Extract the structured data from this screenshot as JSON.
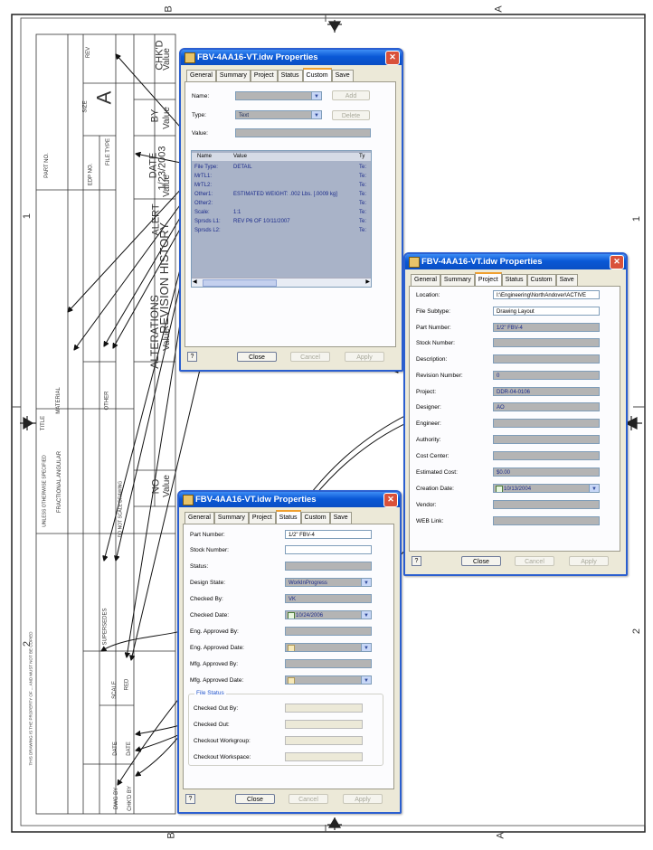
{
  "drawing": {
    "zone_letters": {
      "top_right": "B",
      "bottom_left": "B",
      "top_far_right": "A",
      "bottom_far_right": "A"
    },
    "zone_numbers": {
      "upper": "1",
      "lower": "2"
    },
    "title_block": {
      "part_no_label": "PART NO.",
      "rev_label": "REV",
      "size_label": "SIZE",
      "size_value": "A",
      "edp_no_label": "EDP NO.",
      "file_type_label": "FILE TYPE",
      "title_label": "TITLE",
      "material_label": "MATERIAL",
      "other_label": "OTHER",
      "unless_note": "UNLESS OTHERWISE SPECIFIED",
      "fractional": "FRACTIONAL   ANGULAR",
      "do_not_scale": "DO NOT SCALE DRAWING",
      "supersedes_label": "SUPERSEDES",
      "scale_label": "SCALE",
      "scale_value": "RED",
      "date_label": "DATE",
      "dwg_by_label": "DWG BY",
      "chkd_by_label": "CHK'D BY",
      "proprietary_note": "THIS DRAWING IS THE PROPERTY OF ... AND MUST NOT BE COPIED"
    },
    "revision_history": {
      "header": "REVISION HISTORY",
      "alterations_header": "ALTERATIONS",
      "columns": [
        "NO",
        "ALERT",
        "DATE",
        "BY",
        "CHK'D"
      ],
      "values": {
        "alert": "Value",
        "date": "1/23/2003",
        "by": "Value",
        "chkd": "Value",
        "no": "Value",
        "alterations": "Value"
      }
    }
  },
  "dialog_custom": {
    "title": "FBV-4AA16-VT.idw Properties",
    "tabs": [
      "General",
      "Summary",
      "Project",
      "Status",
      "Custom",
      "Save"
    ],
    "active_tab": "Custom",
    "name_label": "Name:",
    "type_label": "Type:",
    "type_value": "Text",
    "value_label": "Value:",
    "add_button": "Add",
    "delete_button": "Delete",
    "grid_headers": [
      "Name",
      "Value",
      "Ty"
    ],
    "grid_rows": [
      {
        "name": "File Type:",
        "value": "DETAIL",
        "type": "Te:"
      },
      {
        "name": "MrTL1:",
        "value": "",
        "type": "Te:"
      },
      {
        "name": "MrTL2:",
        "value": "",
        "type": "Te:"
      },
      {
        "name": "Other1:",
        "value": "ESTIMATED WEIGHT: .002 Lbs. [.0009 kg]",
        "type": "Te:"
      },
      {
        "name": "Other2:",
        "value": "",
        "type": "Te:"
      },
      {
        "name": "Scale:",
        "value": "1:1",
        "type": "Te:"
      },
      {
        "name": "Sprsds L1:",
        "value": "REV P6 OF 10/11/2007",
        "type": "Te:"
      },
      {
        "name": "Sprsds L2:",
        "value": "",
        "type": "Te:"
      }
    ],
    "close_button": "Close",
    "cancel_button": "Cancel",
    "apply_button": "Apply",
    "help_button": "?"
  },
  "dialog_project": {
    "title": "FBV-4AA16-VT.idw Properties",
    "tabs": [
      "General",
      "Summary",
      "Project",
      "Status",
      "Custom",
      "Save"
    ],
    "active_tab": "Project",
    "fields": [
      {
        "label": "Location:",
        "value": "I:\\Engineering\\NorthAndover\\ACTIVE",
        "style": "white"
      },
      {
        "label": "File Subtype:",
        "value": "Drawing Layout",
        "style": "white"
      },
      {
        "label": "Part Number:",
        "value": "1/2\" FBV-4",
        "style": "blue"
      },
      {
        "label": "Stock Number:",
        "value": "",
        "style": "blue"
      },
      {
        "label": "Description:",
        "value": "",
        "style": "blue"
      },
      {
        "label": "Revision Number:",
        "value": "0",
        "style": "blue"
      },
      {
        "label": "Project:",
        "value": "DDR-04-0106",
        "style": "blue"
      },
      {
        "label": "Designer:",
        "value": "AO",
        "style": "blue"
      },
      {
        "label": "Engineer:",
        "value": "",
        "style": "blue"
      },
      {
        "label": "Authority:",
        "value": "",
        "style": "blue"
      },
      {
        "label": "Cost Center:",
        "value": "",
        "style": "blue"
      },
      {
        "label": "Estimated Cost:",
        "value": "$0.00",
        "style": "blue"
      },
      {
        "label": "Creation Date:",
        "value": "10/13/2004",
        "style": "date"
      },
      {
        "label": "Vendor:",
        "value": "",
        "style": "blue"
      },
      {
        "label": "WEB Link:",
        "value": "",
        "style": "blue"
      }
    ],
    "close_button": "Close",
    "cancel_button": "Cancel",
    "apply_button": "Apply",
    "help_button": "?"
  },
  "dialog_status": {
    "title": "FBV-4AA16-VT.idw Properties",
    "tabs": [
      "General",
      "Summary",
      "Project",
      "Status",
      "Custom",
      "Save"
    ],
    "active_tab": "Status",
    "fields": [
      {
        "label": "Part Number:",
        "value": "1/2\" FBV-4",
        "style": "white"
      },
      {
        "label": "Stock Number:",
        "value": "",
        "style": "white"
      },
      {
        "label": "Status:",
        "value": "",
        "style": "blue"
      },
      {
        "label": "Design State:",
        "value": "WorkInProgress",
        "style": "dropdown"
      },
      {
        "label": "Checked By:",
        "value": "VK",
        "style": "blue"
      },
      {
        "label": "Checked Date:",
        "value": "10/24/2006",
        "style": "date"
      },
      {
        "label": "Eng. Approved By:",
        "value": "",
        "style": "blue"
      },
      {
        "label": "Eng. Approved Date:",
        "value": "",
        "style": "date-off"
      },
      {
        "label": "Mfg. Approved By:",
        "value": "",
        "style": "blue"
      },
      {
        "label": "Mfg. Approved Date:",
        "value": "",
        "style": "date-off"
      }
    ],
    "file_status_legend": "File Status",
    "file_status_fields": [
      {
        "label": "Checked Out By:",
        "value": ""
      },
      {
        "label": "Checked Out:",
        "value": ""
      },
      {
        "label": "Checkout Workgroup:",
        "value": ""
      },
      {
        "label": "Checkout Workspace:",
        "value": ""
      }
    ],
    "close_button": "Close",
    "cancel_button": "Cancel",
    "apply_button": "Apply",
    "help_button": "?"
  },
  "colors": {
    "title_bar": "#0a58d6",
    "dialog_bg": "#ece9d8",
    "grid_bg": "#a9b3c8",
    "field_bg": "#b4b4b4",
    "active_tab_accent": "#f0a030"
  }
}
